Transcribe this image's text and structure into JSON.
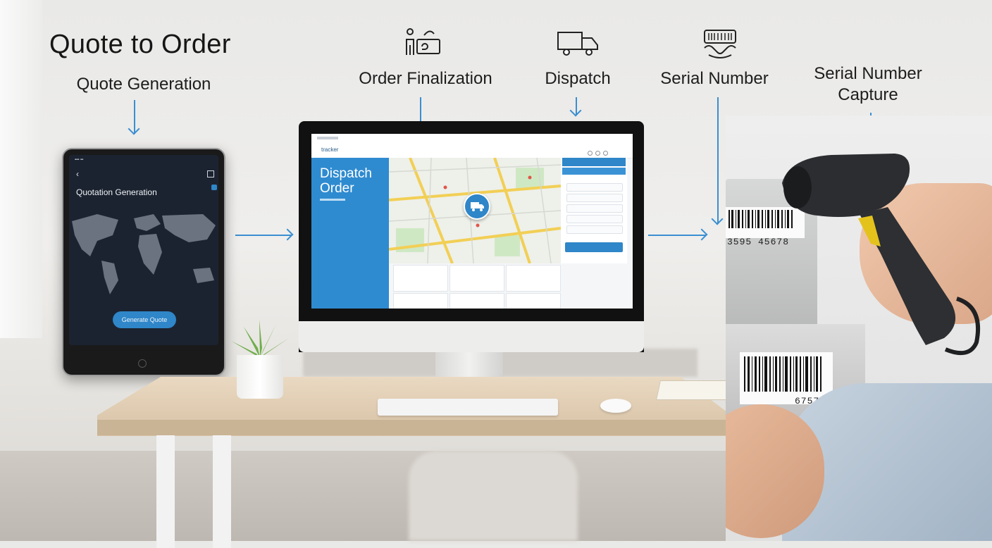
{
  "title": "Quote to Order",
  "steps": {
    "quote": "Quote Generation",
    "order": "Order Finalization",
    "dispatch": "Dispatch",
    "serial": "Serial Number",
    "capture": "Serial Number Capture"
  },
  "tablet": {
    "heading": "Quotation Generation",
    "button": "Generate Quote"
  },
  "monitor": {
    "brand": "tracker",
    "heading": "Dispatch Order"
  },
  "barcodes": {
    "upper": "3595 45678",
    "lower": "67574"
  },
  "colors": {
    "accent": "#2f86c8",
    "arrow": "#3a8fd1"
  }
}
